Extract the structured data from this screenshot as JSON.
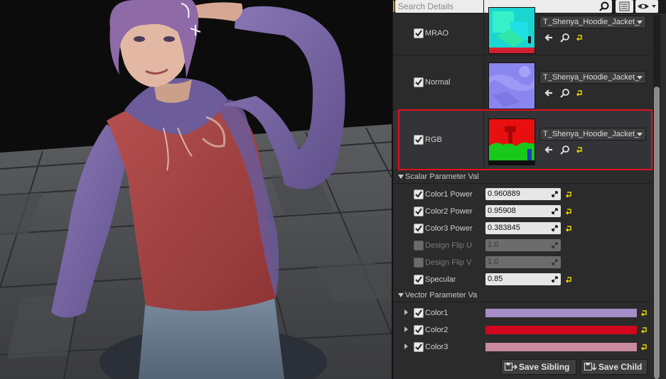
{
  "details": {
    "search_placeholder": "Search Details",
    "texture_params": [
      {
        "label": "MRAO",
        "asset": "T_Shenya_Hoodie_Jacket_"
      },
      {
        "label": "Normal",
        "asset": "T_Shenya_Hoodie_Jacket_"
      },
      {
        "label": "RGB",
        "asset": "T_Shenya_Hoodie_Jacket_"
      }
    ],
    "scalar_section": "Scalar Parameter Val",
    "scalar_params": [
      {
        "label": "Color1 Power",
        "value": "0.960889",
        "enabled": true
      },
      {
        "label": "Color2 Power",
        "value": "0.95908",
        "enabled": true
      },
      {
        "label": "Color3 Power",
        "value": "0.383845",
        "enabled": true
      },
      {
        "label": "Design Flip U",
        "value": "1.0",
        "enabled": false
      },
      {
        "label": "Design Flip V",
        "value": "1.0",
        "enabled": false
      },
      {
        "label": "Specular",
        "value": "0.85",
        "enabled": true
      }
    ],
    "vector_section": "Vector Parameter Va",
    "vector_params": [
      {
        "label": "Color1",
        "color": "#a58dc8"
      },
      {
        "label": "Color2",
        "color": "#d0061e"
      },
      {
        "label": "Color3",
        "color": "#c98a9f"
      }
    ],
    "save_sibling": "Save Sibling",
    "save_child": "Save Child"
  },
  "colors": {
    "highlight": "#e3101a",
    "reset_arrow": "#e8d400",
    "panel_bg": "#2b2b2b"
  },
  "icons": [
    "search-icon",
    "list-view-icon",
    "eye-icon",
    "use-selected-icon",
    "browse-icon",
    "reset-icon",
    "drag-arrows-icon",
    "save-icon",
    "checkmark-icon"
  ]
}
